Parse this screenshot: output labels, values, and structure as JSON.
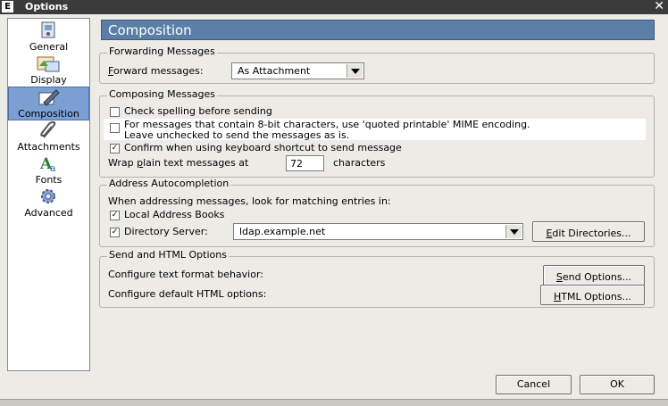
{
  "window": {
    "app_icon": "E",
    "title": "Options",
    "close_glyph": "✕"
  },
  "sidebar": {
    "items": [
      {
        "label": "General",
        "icon": "general-icon"
      },
      {
        "label": "Display",
        "icon": "display-icon"
      },
      {
        "label": "Composition",
        "icon": "composition-icon",
        "selected": true
      },
      {
        "label": "Attachments",
        "icon": "attachments-icon"
      },
      {
        "label": "Fonts",
        "icon": "fonts-icon"
      },
      {
        "label": "Advanced",
        "icon": "advanced-icon"
      }
    ]
  },
  "header": {
    "title": "Composition"
  },
  "forwarding": {
    "title": "Forwarding Messages",
    "label_accel": "F",
    "label_rest": "orward messages:",
    "value": "As Attachment"
  },
  "composing": {
    "title": "Composing Messages",
    "check_spelling": {
      "label": "Check spelling before sending",
      "checked": false
    },
    "quoted_printable": {
      "line1": "For messages that contain 8-bit characters, use 'quoted printable' MIME encoding.",
      "line2": "Leave unchecked to send the messages as is.",
      "checked": false
    },
    "confirm_shortcut": {
      "label": "Confirm when using keyboard shortcut to send message",
      "checked": true
    },
    "wrap": {
      "label_pre": "Wrap ",
      "label_accel": "p",
      "label_post": "lain text messages at",
      "value": "72",
      "suffix": "characters"
    }
  },
  "autocomplete": {
    "title": "Address Autocompletion",
    "intro": "When addressing messages, look for matching entries in:",
    "local_books": {
      "label": "Local Address Books",
      "checked": true
    },
    "directory": {
      "label": "Directory Server:",
      "checked": true,
      "value": "ldap.example.net"
    },
    "edit_button": {
      "accel": "E",
      "rest": "dit Directories..."
    }
  },
  "send_html": {
    "title": "Send and HTML Options",
    "text_format_label": "Configure text format behavior:",
    "send_button": {
      "accel": "S",
      "rest": "end Options..."
    },
    "html_label": "Configure default HTML options:",
    "html_button": {
      "accel": "H",
      "rest": "TML Options..."
    }
  },
  "footer": {
    "cancel": "Cancel",
    "ok": "OK"
  },
  "colors": {
    "accent": "#5a7ea6",
    "selection": "#7b9fd3",
    "titlebar": "#3b3b3b"
  }
}
